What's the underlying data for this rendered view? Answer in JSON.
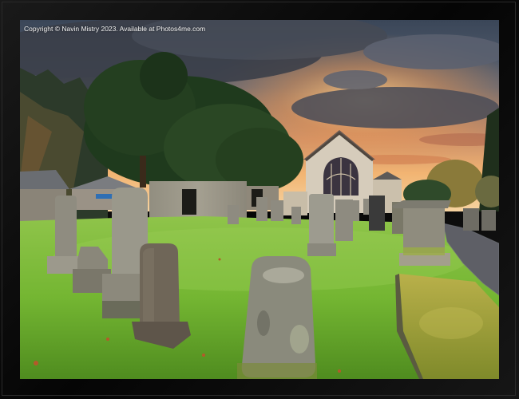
{
  "watermark": {
    "text": "Copyright © Navin Mistry 2023. Available at Photos4me.com"
  },
  "colors": {
    "frame": "#0a0a0a",
    "sky_top": "#3c4a5e",
    "sunset": "#f0a45a",
    "grass": "#7fbf3a",
    "stone": "#9a9a8c"
  },
  "subjects": [
    "churchyard",
    "church",
    "gravestones",
    "yew-tree",
    "sunset-sky",
    "gravel-path"
  ]
}
